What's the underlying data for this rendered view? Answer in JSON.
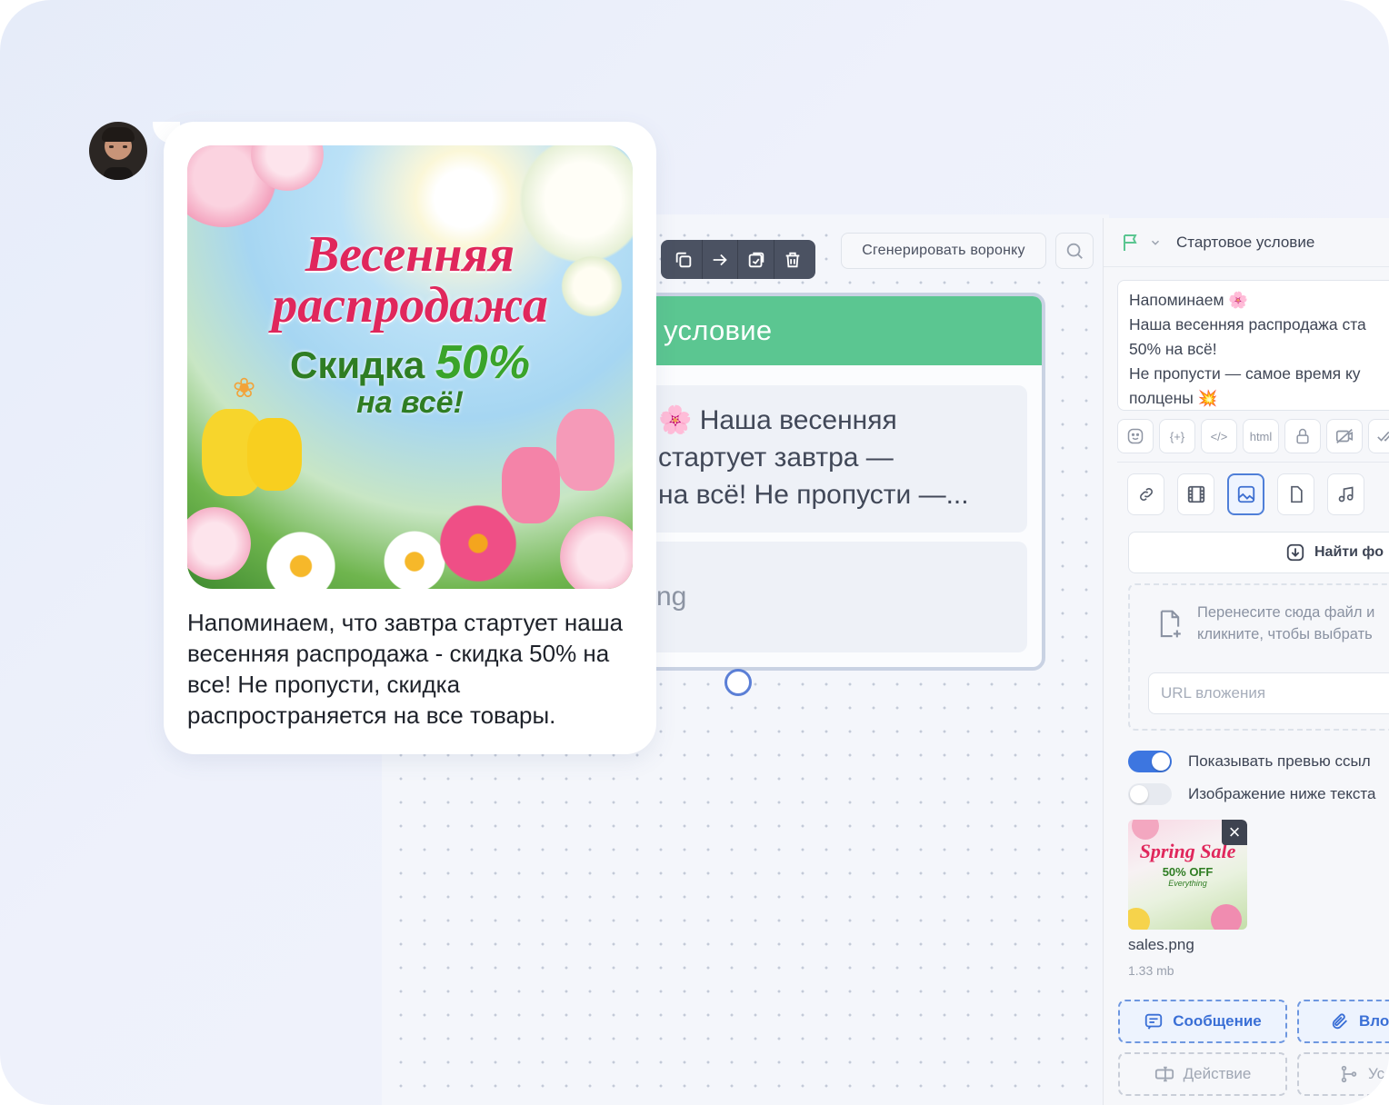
{
  "toolbar": {
    "icons": [
      "copy-icon",
      "arrow-right-icon",
      "paste-icon",
      "trash-icon"
    ],
    "generate_funnel_label": "Сгенерировать воронку"
  },
  "node": {
    "header": "условие",
    "text_lines": [
      "🌸 Наша весенняя",
      "стартует завтра —",
      "на всё! Не пропусти —..."
    ],
    "file_label": "ng"
  },
  "panel": {
    "title": "Стартовое условие",
    "message_lines": [
      "Напоминаем 🌸",
      "Наша весенняя распродажа ста",
      "50% на всё!",
      "Не пропусти — самое время ку",
      "полцены 💥"
    ],
    "format_buttons": [
      "emoji-icon",
      "{+}",
      "</>",
      "html",
      "lock-icon",
      "no-preview-icon",
      "check-icon"
    ],
    "media_buttons": [
      "link-icon",
      "video-icon",
      "image-icon",
      "file-icon",
      "audio-icon"
    ],
    "find_photo_label": "Найти фо",
    "drop_text_1": "Перенесите сюда файл и",
    "drop_text_2": "кликните, чтобы выбрать",
    "url_placeholder": "URL вложения",
    "toggle_preview_label": "Показывать превью ссыл",
    "toggle_preview_on": true,
    "toggle_below_label": "Изображение ниже текста",
    "toggle_below_on": false,
    "thumb": {
      "title": "Spring Sale",
      "sub": "50% OFF",
      "sub2": "Everything"
    },
    "file_name": "sales.png",
    "file_size": "1.33 mb",
    "add_message_label": "Сообщение",
    "add_attachment_label": "Вло",
    "add_action_label": "Действие",
    "add_condition_label": "Усл"
  },
  "chat": {
    "promo_title_1": "Весенняя",
    "promo_title_2": "распродажа",
    "promo_sub_1": "Скидка",
    "promo_sub_pct": "50%",
    "promo_sub_2": "на всё!",
    "message": "Напоминаем, что завтра стартует наша весенняя распродажа - скидка 50% на все! Не пропусти, скидка распространяется на все товары."
  },
  "colors": {
    "accent": "#3d76e0",
    "node_header": "#5bc691",
    "toolbar_dark": "#4b5262",
    "promo_title": "#e0275c",
    "promo_green": "#2f7d23"
  }
}
